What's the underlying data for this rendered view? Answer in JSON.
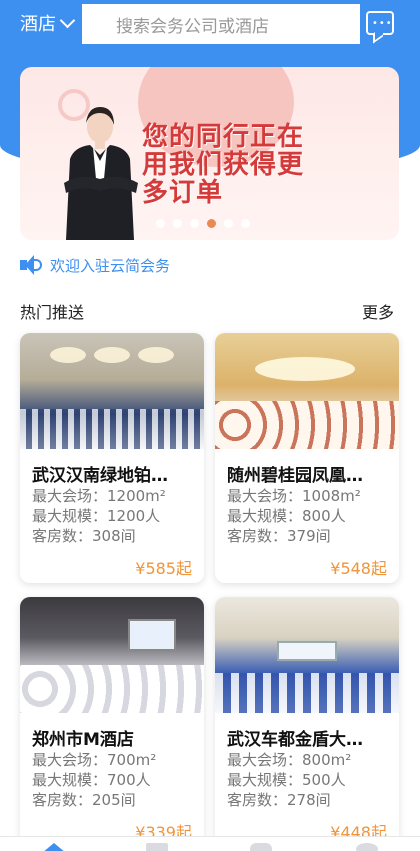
{
  "header": {
    "city": "酒店",
    "search_placeholder": "搜索会务公司或酒店"
  },
  "banner": {
    "headline_line1": "您的同行正在",
    "headline_line2": "用我们获得更",
    "headline_line3": "多订单",
    "dot_count": 6,
    "active_dot": 3
  },
  "notice": {
    "text": "欢迎入驻云简会务"
  },
  "section": {
    "title": "热门推送",
    "more": "更多"
  },
  "hotels": [
    {
      "name": "武汉汉南绿地铂…",
      "venue": "最大会场：1200m²",
      "scale": "最大规模：1200人",
      "rooms": "客房数：308间",
      "price": "¥585起"
    },
    {
      "name": "随州碧桂园凤凰…",
      "venue": "最大会场：1008m²",
      "scale": "最大规模：800人",
      "rooms": "客房数：379间",
      "price": "¥548起"
    },
    {
      "name": "郑州市M酒店",
      "venue": "最大会场：700m²",
      "scale": "最大规模：700人",
      "rooms": "客房数：205间",
      "price": "¥339起"
    },
    {
      "name": "武汉车都金盾大…",
      "venue": "最大会场：800m²",
      "scale": "最大规模：500人",
      "rooms": "客房数：278间",
      "price": "¥448起"
    }
  ],
  "colors": {
    "primary": "#3d8ff0",
    "price": "#f0953a",
    "headline": "#d43a3a"
  },
  "icons": [
    "chevron-down-icon",
    "message-icon",
    "speaker-icon",
    "home-tab-icon"
  ]
}
